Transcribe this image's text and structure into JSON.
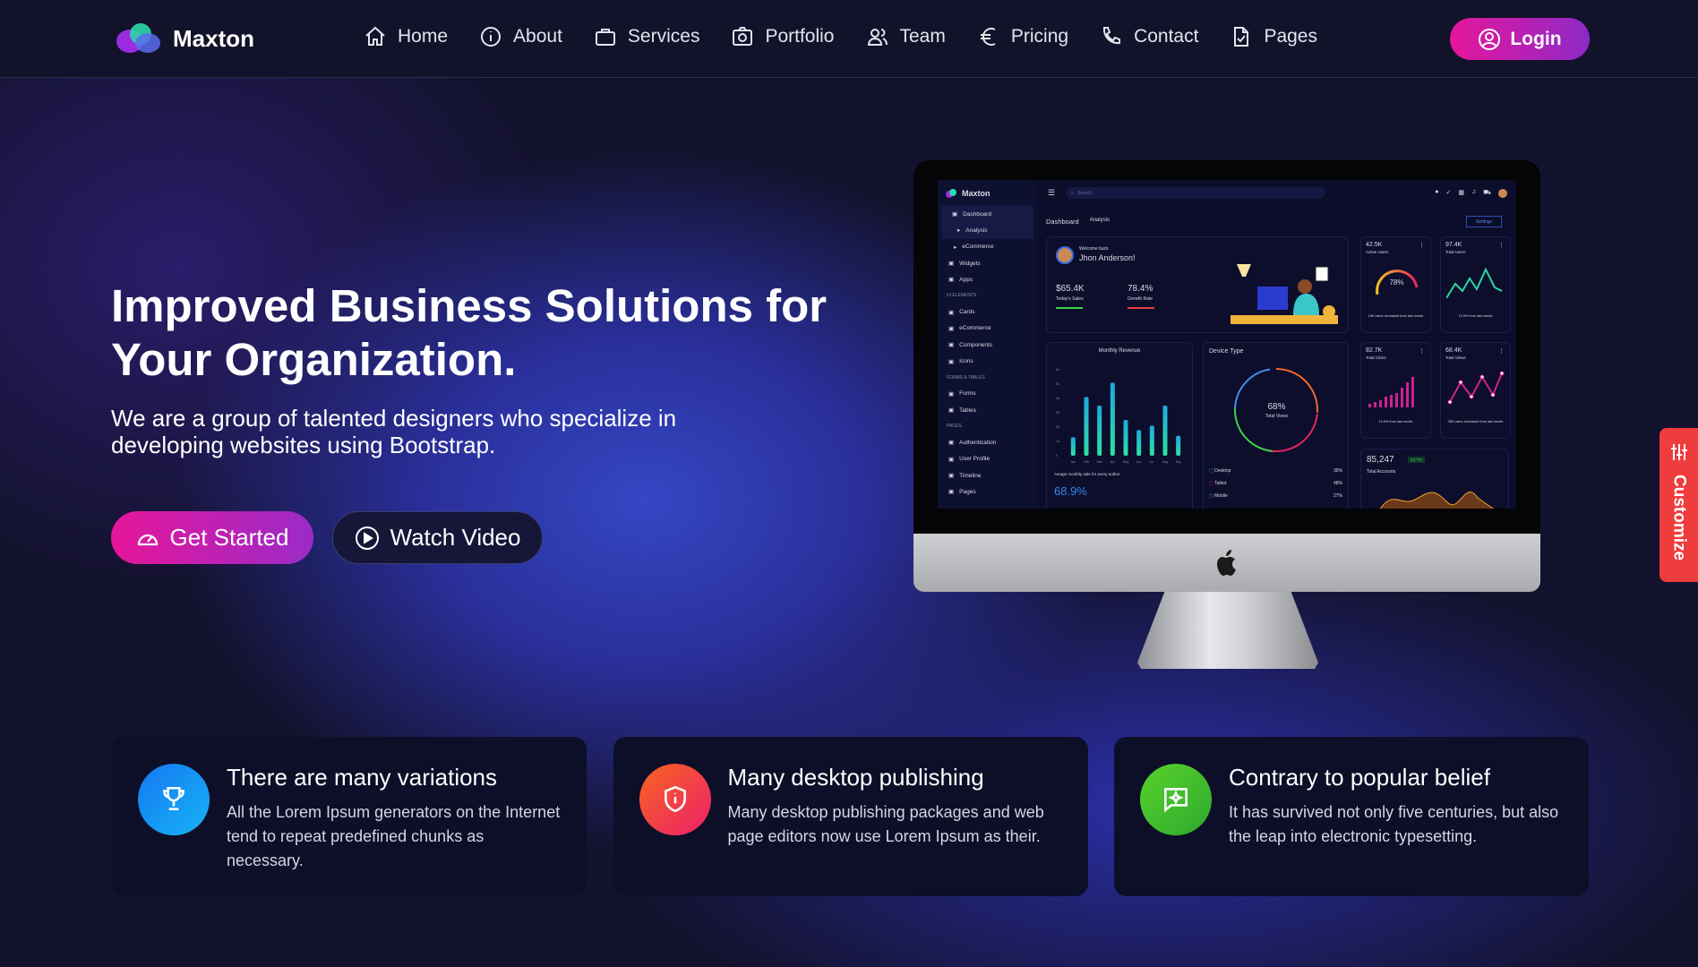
{
  "brand": "Maxton",
  "nav": {
    "items": [
      {
        "label": "Home",
        "icon": "home-icon"
      },
      {
        "label": "About",
        "icon": "info-icon"
      },
      {
        "label": "Services",
        "icon": "briefcase-icon"
      },
      {
        "label": "Portfolio",
        "icon": "camera-icon"
      },
      {
        "label": "Team",
        "icon": "people-icon"
      },
      {
        "label": "Pricing",
        "icon": "euro-icon"
      },
      {
        "label": "Contact",
        "icon": "phone-icon"
      },
      {
        "label": "Pages",
        "icon": "file-check-icon"
      }
    ],
    "login": "Login"
  },
  "hero": {
    "title": "Improved Business Solutions for Your Organization.",
    "subtitle": "We are a group of talented designers who specialize in developing websites using Bootstrap.",
    "get_started": "Get Started",
    "watch_video": "Watch Video"
  },
  "customize": "Customize",
  "features": [
    {
      "title": "There are many variations",
      "text": "All the Lorem Ipsum generators on the Internet tend to repeat predefined chunks as necessary.",
      "icon": "trophy-icon",
      "color": "#1e8ef5"
    },
    {
      "title": "Many desktop publishing",
      "text": "Many desktop publishing packages and web page editors now use Lorem Ipsum as their.",
      "icon": "shield-icon",
      "color": "#f2483a"
    },
    {
      "title": "Contrary to popular belief",
      "text": "It has survived not only five centuries, but also the leap into electronic typesetting.",
      "icon": "chat-icon",
      "color": "#4fcc2d"
    }
  ],
  "dashboard": {
    "brand": "Maxton",
    "search": "Search",
    "sidebar": [
      {
        "label": "Dashboard"
      },
      {
        "label": "Analysis",
        "sub": true
      },
      {
        "label": "eCommerce",
        "sub": true
      },
      {
        "label": "Widgets"
      },
      {
        "label": "Apps"
      },
      {
        "caption": "UI ELEMENTS"
      },
      {
        "label": "Cards"
      },
      {
        "label": "eCommerce"
      },
      {
        "label": "Components"
      },
      {
        "label": "Icons"
      },
      {
        "caption": "FORMS & TABLES"
      },
      {
        "label": "Forms"
      },
      {
        "label": "Tables"
      },
      {
        "caption": "PAGES"
      },
      {
        "label": "Authentication"
      },
      {
        "label": "User Profile"
      },
      {
        "label": "Timeline"
      },
      {
        "label": "Pages"
      }
    ],
    "breadcrumb": [
      "Dashboard",
      "Analysis"
    ],
    "settings": "Settings",
    "welcome": {
      "greet": "Welcome back",
      "name": "Jhon Anderson!",
      "sales": "$65.4K",
      "sales_label": "Today's Sales",
      "growth": "78.4%",
      "growth_label": "Growth Rate"
    },
    "active_users": {
      "value": "42.5K",
      "label": "Active Users",
      "gauge": "78%",
      "note": "24K users increased from last month"
    },
    "total_users": {
      "value": "97.4K",
      "label": "Total Users",
      "note": "12.5% from last month"
    },
    "monthly_revenue": {
      "title": "Monthly Revenue",
      "months": [
        "Jan",
        "Feb",
        "Mar",
        "Apr",
        "May",
        "Jun",
        "Jul",
        "Aug",
        "Sep"
      ],
      "values": [
        13,
        41,
        35,
        51,
        25,
        18,
        21,
        35,
        14
      ],
      "yticks": [
        "0",
        "10",
        "20",
        "30",
        "40",
        "50",
        "60"
      ],
      "note": "Avrage monthly sale for every author",
      "value": "68.9%"
    },
    "device": {
      "title": "Device Type",
      "center": "68%",
      "center_label": "Total Views",
      "rows": [
        {
          "label": "Desktop",
          "pct": "35%"
        },
        {
          "label": "Tablet",
          "pct": "48%"
        },
        {
          "label": "Mobile",
          "pct": "27%"
        }
      ]
    },
    "total_clicks": {
      "value": "82.7K",
      "label": "Total Clicks",
      "note": "12.5% from last month"
    },
    "total_views": {
      "value": "68.4K",
      "label": "Total Views",
      "note": "35K users increased from last month"
    },
    "accounts": {
      "value": "85,247",
      "badge": "23.7%",
      "label": "Total Accounts"
    }
  }
}
